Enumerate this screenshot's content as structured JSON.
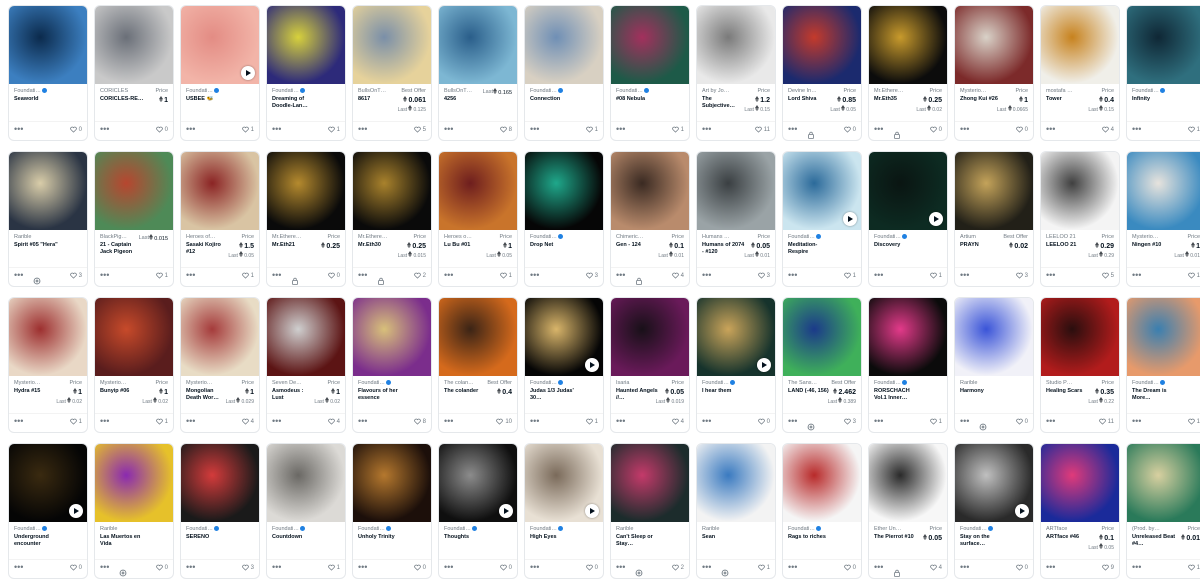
{
  "ui": {
    "price_label": "Price",
    "more": "•••"
  },
  "cards": [
    {
      "collection": "Foundati…",
      "verified": true,
      "name": "Seaworld",
      "price": "",
      "last": "",
      "favorites": "0",
      "img": "#3c7fc0,#0b2a4c",
      "play": false,
      "icon": ""
    },
    {
      "collection": "CORICLES",
      "verified": false,
      "name": "CORICLES-RE…",
      "label": "Price",
      "price": "1",
      "last": "",
      "favorites": "0",
      "img": "#c9c9c9,#6a6f78",
      "play": false,
      "icon": ""
    },
    {
      "collection": "Foundati…",
      "verified": true,
      "name": "USBEE 🐝",
      "price": "",
      "last": "",
      "favorites": "1",
      "img": "#f2b4a8,#e38c84",
      "play": true,
      "icon": ""
    },
    {
      "collection": "Foundati…",
      "verified": true,
      "name": "Dreaming of Doodle-Lan…",
      "price": "",
      "last": "",
      "favorites": "1",
      "img": "#2d2a7a,#d7d13c",
      "play": false,
      "icon": ""
    },
    {
      "collection": "BullsOnT…",
      "verified": false,
      "name": "8617",
      "label": "Best Offer",
      "price": "0.061",
      "last": "0.125",
      "favorites": "5",
      "img": "#e6d29b,#7a8fa8",
      "play": false,
      "icon": ""
    },
    {
      "collection": "BullsOnT…",
      "verified": false,
      "name": "4256",
      "label": "Last",
      "price": "0.165",
      "last": "",
      "favorites": "8",
      "img": "#7db7d3,#2a5e8a",
      "play": false,
      "icon": ""
    },
    {
      "collection": "Foundati…",
      "verified": true,
      "name": "Connection",
      "price": "",
      "last": "",
      "favorites": "1",
      "img": "#d8d0c2,#6f8fb5",
      "play": false,
      "icon": ""
    },
    {
      "collection": "Foundati…",
      "verified": true,
      "name": "#08 Nebula",
      "price": "",
      "last": "",
      "favorites": "1",
      "img": "#1d5a48,#a3305d",
      "play": false,
      "icon": ""
    },
    {
      "collection": "Art by Jo…",
      "verified": false,
      "name": "The Subjective…",
      "label": "Price",
      "price": "1.2",
      "last": "0.15",
      "favorites": "11",
      "img": "#e9e9e9,#7a7a7a",
      "play": false,
      "icon": ""
    },
    {
      "collection": "Devine In…",
      "verified": false,
      "name": "Lord Shiva",
      "label": "Price",
      "price": "0.85",
      "last": "0.05",
      "favorites": "0",
      "img": "#1b2a6e,#c43a2b",
      "play": false,
      "icon": "lock"
    },
    {
      "collection": "Mr.Ethere…",
      "verified": false,
      "name": "Mr.Eth35",
      "label": "Price",
      "price": "0.25",
      "last": "0.02",
      "favorites": "0",
      "img": "#0c0c0c,#c89a2c",
      "play": false,
      "icon": "lock"
    },
    {
      "collection": "Mysterio…",
      "verified": false,
      "name": "Zhong Kui #26",
      "label": "Price",
      "price": "1",
      "last": "0.0665",
      "favorites": "0",
      "img": "#7c2a2a,#d9d2c8",
      "play": false,
      "icon": ""
    },
    {
      "collection": "mostafa …",
      "verified": false,
      "name": "Tower",
      "label": "Price",
      "price": "0.4",
      "last": "0.15",
      "favorites": "4",
      "img": "#f0efe9,#c7821e",
      "play": false,
      "icon": ""
    },
    {
      "collection": "Foundati…",
      "verified": true,
      "name": "Infinity",
      "price": "",
      "last": "",
      "favorites": "1",
      "img": "#2f6f7e,#0f2735",
      "play": false,
      "icon": ""
    },
    {
      "collection": "Rarible",
      "verified": false,
      "name": "Spirit #05 \"Hera\"",
      "price": "",
      "last": "",
      "favorites": "3",
      "img": "#2a3444,#d9cda9",
      "play": false,
      "icon": "flower"
    },
    {
      "collection": "BlackPig…",
      "verified": false,
      "name": "21 - Captain Jack Pigeon",
      "label": "Last",
      "price": "0.015",
      "last": "",
      "favorites": "1",
      "img": "#4e8a57,#b7462f",
      "play": false,
      "icon": ""
    },
    {
      "collection": "Heroes of…",
      "verified": false,
      "name": "Sasaki Kojiro #12",
      "label": "Price",
      "price": "1.5",
      "last": "0.05",
      "favorites": "1",
      "img": "#d9c4a3,#8b2424",
      "play": false,
      "icon": ""
    },
    {
      "collection": "Mr.Ethere…",
      "verified": false,
      "name": "Mr.Eth21",
      "label": "Price",
      "price": "0.25",
      "last": "",
      "favorites": "0",
      "img": "#0a0a0a,#b58a2e",
      "play": false,
      "icon": "lock"
    },
    {
      "collection": "Mr.Ethere…",
      "verified": false,
      "name": "Mr.Eth30",
      "label": "Price",
      "price": "0.25",
      "last": "0.015",
      "favorites": "2",
      "img": "#0a0a0a,#a9822c",
      "play": false,
      "icon": "lock"
    },
    {
      "collection": "Heroes o…",
      "verified": false,
      "name": "Lu Bu #01",
      "label": "Price",
      "price": "1",
      "last": "0.05",
      "favorites": "1",
      "img": "#c9742b,#6e1e1e",
      "play": false,
      "icon": ""
    },
    {
      "collection": "Foundati…",
      "verified": true,
      "name": "Drop Net",
      "price": "",
      "last": "",
      "favorites": "3",
      "img": "#060606,#1fa88b",
      "play": false,
      "icon": ""
    },
    {
      "collection": "Chimeric…",
      "verified": false,
      "name": "Gen - 124",
      "label": "Price",
      "price": "0.1",
      "last": "0.01",
      "favorites": "4",
      "img": "#b98b6c,#3a2a22",
      "play": false,
      "icon": "lock"
    },
    {
      "collection": "Humans …",
      "verified": false,
      "name": "Humans of 2074 - #120",
      "label": "Price",
      "price": "0.05",
      "last": "0.01",
      "favorites": "3",
      "img": "#9aa3a6,#3a3f42",
      "play": false,
      "icon": ""
    },
    {
      "collection": "Foundati…",
      "verified": true,
      "name": "Meditation-Respire",
      "price": "",
      "last": "",
      "favorites": "1",
      "img": "#cbe5ef,#2b6a9a",
      "play": true,
      "icon": ""
    },
    {
      "collection": "Foundati…",
      "verified": true,
      "name": "Discovery",
      "price": "",
      "last": "",
      "favorites": "1",
      "img": "#0d2b22,#0a1512",
      "play": true,
      "icon": ""
    },
    {
      "collection": "Artium",
      "verified": false,
      "name": "PRAYN",
      "label": "Best Offer",
      "price": "0.02",
      "last": "",
      "favorites": "3",
      "img": "#222018,#c4a35a",
      "play": false,
      "icon": ""
    },
    {
      "collection": "LEELOO 21",
      "verified": false,
      "name": "LEELOO 21",
      "label": "Price",
      "price": "0.29",
      "last": "0.29",
      "favorites": "5",
      "img": "#f4f4f4,#404040",
      "play": false,
      "icon": ""
    },
    {
      "collection": "Mysterio…",
      "verified": false,
      "name": "Ningen #10",
      "label": "Price",
      "price": "1",
      "last": "0.01",
      "favorites": "1",
      "img": "#3a8ac0,#e7e3dd",
      "play": false,
      "icon": ""
    },
    {
      "collection": "Mysterio…",
      "verified": false,
      "name": "Hydra #15",
      "label": "Price",
      "price": "1",
      "last": "0.02",
      "favorites": "1",
      "img": "#e9d8c6,#9d2f2f",
      "play": false,
      "icon": ""
    },
    {
      "collection": "Mysterio…",
      "verified": false,
      "name": "Bunyip #06",
      "label": "Price",
      "price": "1",
      "last": "0.02",
      "favorites": "1",
      "img": "#5a1d1d,#c74a2a",
      "play": false,
      "icon": ""
    },
    {
      "collection": "Mysterio…",
      "verified": false,
      "name": "Mongolian Death Wor…",
      "label": "Price",
      "price": "1",
      "last": "0.029",
      "favorites": "4",
      "img": "#e8dcc5,#a53b3b",
      "play": false,
      "icon": ""
    },
    {
      "collection": "Seven De…",
      "verified": false,
      "name": "Asmodeus : Lust",
      "label": "Price",
      "price": "1",
      "last": "0.02",
      "favorites": "4",
      "img": "#5c1414,#cfcfcf",
      "play": false,
      "icon": ""
    },
    {
      "collection": "Foundati…",
      "verified": true,
      "name": "Flavours of her essence",
      "price": "",
      "last": "",
      "favorites": "8",
      "img": "#7b2d8c,#d8c07a",
      "play": false,
      "icon": ""
    },
    {
      "collection": "The colan…",
      "verified": false,
      "name": "The colander",
      "label": "Best Offer",
      "price": "0.4",
      "last": "",
      "favorites": "10",
      "img": "#d56a1c,#3b2416",
      "play": false,
      "icon": ""
    },
    {
      "collection": "Foundati…",
      "verified": true,
      "name": "Judas 1/3 Judas' 30…",
      "price": "",
      "last": "",
      "favorites": "1",
      "img": "#050505,#d9b56a",
      "play": true,
      "icon": ""
    },
    {
      "collection": "Isaria",
      "verified": false,
      "name": "Haunted Angels //…",
      "label": "Price",
      "price": "0.05",
      "last": "0.019",
      "favorites": "4",
      "img": "#6a1a5a,#181018",
      "play": false,
      "icon": ""
    },
    {
      "collection": "Foundati…",
      "verified": true,
      "name": "I hear them",
      "price": "",
      "last": "",
      "favorites": "0",
      "img": "#16332c,#caa45a",
      "play": true,
      "icon": ""
    },
    {
      "collection": "The Sans…",
      "verified": false,
      "name": "LAND (-46, 156)",
      "label": "Best Offer",
      "price": "2.462",
      "last": "0.389",
      "favorites": "3",
      "img": "#3fb05a,#1b3a8a",
      "play": false,
      "icon": "flower"
    },
    {
      "collection": "Foundati…",
      "verified": true,
      "name": "RORSCHACH Vol.1 Inner…",
      "price": "",
      "last": "",
      "favorites": "1",
      "img": "#0b0b0b,#e33a8a",
      "play": false,
      "icon": ""
    },
    {
      "collection": "Rarible",
      "verified": false,
      "name": "Harmony",
      "price": "",
      "last": "",
      "favorites": "0",
      "img": "#f1f1f8,#3a54d8",
      "play": false,
      "icon": "flower"
    },
    {
      "collection": "Studio P…",
      "verified": false,
      "name": "Healing Scars",
      "label": "Price",
      "price": "0.35",
      "last": "0.22",
      "favorites": "11",
      "img": "#b21c1c,#2a0e0e",
      "play": false,
      "icon": ""
    },
    {
      "collection": "Foundati…",
      "verified": true,
      "name": "The Dream is More…",
      "price": "",
      "last": "",
      "favorites": "1",
      "img": "#e79a6b,#3a7fb0",
      "play": false,
      "icon": ""
    },
    {
      "collection": "Foundati…",
      "verified": true,
      "name": "Underground encounter",
      "price": "",
      "last": "",
      "favorites": "0",
      "img": "#050505,#3a2a10",
      "play": true,
      "icon": ""
    },
    {
      "collection": "Rarible",
      "verified": false,
      "name": "Las Muertos en Vida",
      "price": "",
      "last": "",
      "favorites": "0",
      "img": "#e6c12a,#8a2ab0",
      "play": false,
      "icon": "flower"
    },
    {
      "collection": "Foundati…",
      "verified": true,
      "name": "SERENO",
      "price": "",
      "last": "",
      "favorites": "3",
      "img": "#1a1a1a,#d33b3b",
      "play": false,
      "icon": ""
    },
    {
      "collection": "Foundati…",
      "verified": true,
      "name": "Countdown",
      "price": "",
      "last": "",
      "favorites": "1",
      "img": "#dcdad6,#6a6864",
      "play": false,
      "icon": ""
    },
    {
      "collection": "Foundati…",
      "verified": true,
      "name": "Unholy Trinity",
      "price": "",
      "last": "",
      "favorites": "0",
      "img": "#1c0f0a,#b5782e",
      "play": false,
      "icon": ""
    },
    {
      "collection": "Foundati…",
      "verified": true,
      "name": "Thoughts",
      "price": "",
      "last": "",
      "favorites": "0",
      "img": "#0f0f0f,#8c8c8c",
      "play": true,
      "icon": ""
    },
    {
      "collection": "Foundati…",
      "verified": true,
      "name": "High Eyes",
      "price": "",
      "last": "",
      "favorites": "0",
      "img": "#e8e0d4,#7a6a5a",
      "play": true,
      "icon": ""
    },
    {
      "collection": "Rarible",
      "verified": false,
      "name": "Can't Sleep or Stay…",
      "price": "",
      "last": "",
      "favorites": "2",
      "img": "#1c2c2c,#c43a6a",
      "play": false,
      "icon": "flower"
    },
    {
      "collection": "Rarible",
      "verified": false,
      "name": "Sean",
      "price": "",
      "last": "",
      "favorites": "1",
      "img": "#f3f3f3,#3a7ac0",
      "play": false,
      "icon": "flower"
    },
    {
      "collection": "Foundati…",
      "verified": true,
      "name": "Rags to riches",
      "price": "",
      "last": "",
      "favorites": "0",
      "img": "#f5f5f5,#b82a2a",
      "play": false,
      "icon": ""
    },
    {
      "collection": "Ether Un…",
      "verified": false,
      "name": "The Pierrot #10",
      "label": "Price",
      "price": "0.05",
      "last": "",
      "favorites": "4",
      "img": "#f7f7f7,#2a2a2a",
      "play": false,
      "icon": "lock"
    },
    {
      "collection": "Foundati…",
      "verified": true,
      "name": "Stay on the surface…",
      "price": "",
      "last": "",
      "favorites": "0",
      "img": "#2a2a2a,#c0c0c0",
      "play": true,
      "icon": ""
    },
    {
      "collection": "ARTface",
      "verified": false,
      "name": "ARTface #46",
      "label": "Price",
      "price": "0.1",
      "last": "0.05",
      "favorites": "9",
      "img": "#1a2a9a,#e03a7a",
      "play": false,
      "icon": ""
    },
    {
      "collection": "(Prod. by…",
      "verified": false,
      "name": "Unreleased Beat #4…",
      "label": "Price",
      "price": "0.01",
      "last": "",
      "favorites": "1",
      "img": "#2a7a5a,#d8d0a0",
      "play": false,
      "icon": ""
    }
  ]
}
